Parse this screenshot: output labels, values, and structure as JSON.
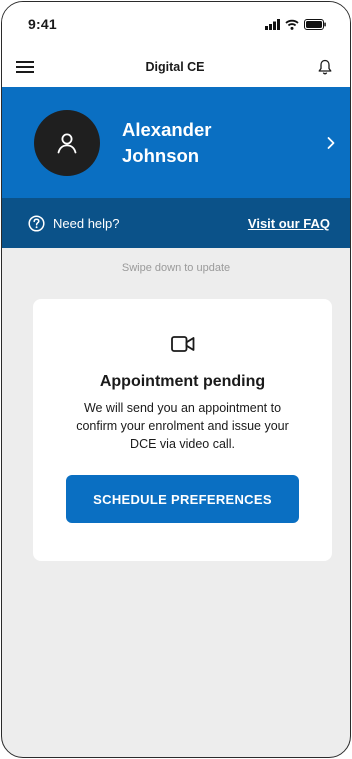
{
  "status_bar": {
    "time": "9:41"
  },
  "header": {
    "title": "Digital CE",
    "menu_icon": "hamburger-menu-icon",
    "bell_icon": "bell-icon"
  },
  "profile": {
    "first_name": "Alexander",
    "last_name": "Johnson",
    "avatar_icon": "user-icon",
    "chevron_icon": "chevron-right-icon"
  },
  "help": {
    "label": "Need help?",
    "link": "Visit our FAQ"
  },
  "swipe_hint": "Swipe down to update",
  "card": {
    "icon": "video-camera-icon",
    "title": "Appointment pending",
    "description": "We will send you an appointment to confirm your enrolment and issue your DCE via video call.",
    "button": "SCHEDULE PREFERENCES"
  },
  "colors": {
    "primary": "#0a6fc2",
    "help_bar": "#0b5289",
    "background": "#ededed"
  }
}
